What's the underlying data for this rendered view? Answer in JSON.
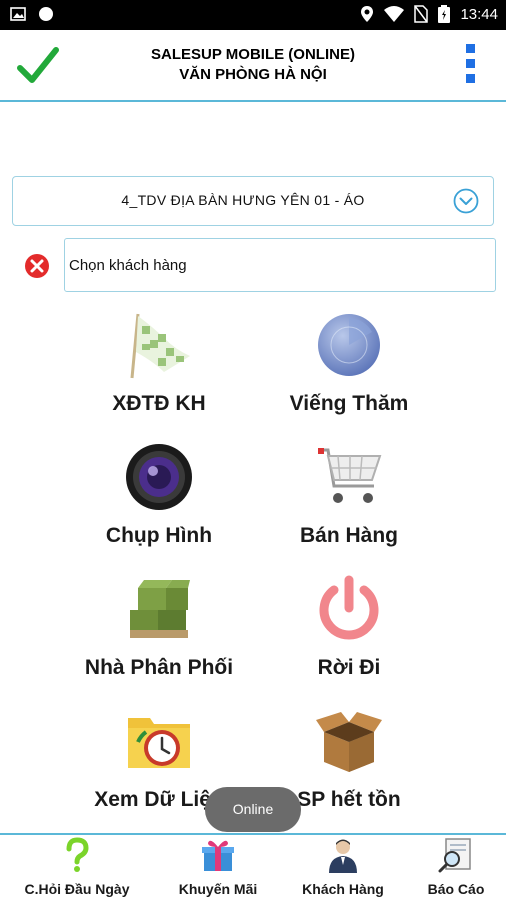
{
  "status_bar": {
    "time": "13:44",
    "left_icons": [
      "image-icon",
      "circle-icon"
    ],
    "right_icons": [
      "location-icon",
      "wifi-icon",
      "no-sim-icon",
      "battery-icon"
    ]
  },
  "header": {
    "title_line1": "SALESUP MOBILE (ONLINE)",
    "title_line2": "VĂN PHÒNG HÀ NỘI",
    "accent_color": "#5bb8d8",
    "check_color": "#22a93a",
    "menu_color": "#1f6fe3"
  },
  "route_select": {
    "value": "4_TDV ĐỊA BÀN HƯNG YÊN 01 - ÁO"
  },
  "customer": {
    "value": "Chọn khách hàng"
  },
  "tiles": [
    {
      "label": "XĐTĐ KH",
      "icon": "checkered-flag-icon"
    },
    {
      "label": "Viếng Thăm",
      "icon": "radar-icon"
    },
    {
      "label": "Chụp Hình",
      "icon": "camera-lens-icon"
    },
    {
      "label": "Bán Hàng",
      "icon": "shopping-cart-icon"
    },
    {
      "label": "Nhà Phân Phối",
      "icon": "warehouse-boxes-icon"
    },
    {
      "label": "Rời Đi",
      "icon": "power-icon"
    },
    {
      "label": "Xem Dữ Liệu",
      "icon": "folder-clock-icon"
    },
    {
      "label": "SP hết tồn",
      "icon": "open-box-icon"
    }
  ],
  "toast": {
    "text": "Online"
  },
  "bottom_nav": [
    {
      "label": "C.Hỏi Đầu Ngày",
      "icon": "question-mark-icon"
    },
    {
      "label": "Khuyến Mãi",
      "icon": "gift-box-icon"
    },
    {
      "label": "Khách Hàng",
      "icon": "customer-person-icon"
    },
    {
      "label": "Báo Cáo",
      "icon": "report-magnifier-icon"
    }
  ]
}
